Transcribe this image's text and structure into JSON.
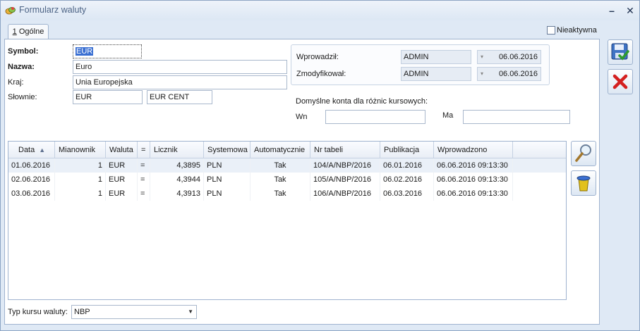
{
  "window": {
    "title": "Formularz waluty"
  },
  "tabs": [
    {
      "accel": "1",
      "label": " Ogólne"
    }
  ],
  "nieaktywna_label": "Nieaktywna",
  "form": {
    "symbol_label": "Symbol:",
    "symbol_value": "EUR",
    "nazwa_label": "Nazwa:",
    "nazwa_value": "Euro",
    "kraj_label": "Kraj:",
    "kraj_value": "Unia Europejska",
    "slownie_label": "Słownie:",
    "slownie_value1": "EUR",
    "slownie_value2": "EUR CENT"
  },
  "info": {
    "wprowadzil_label": "Wprowadził:",
    "wprowadzil_user": "ADMIN",
    "wprowadzil_date": "06.06.2016",
    "zmodyfikowal_label": "Zmodyfikował:",
    "zmodyfikowal_user": "ADMIN",
    "zmodyfikowal_date": "06.06.2016"
  },
  "konta": {
    "title": "Domyślne konta dla różnic kursowych:",
    "wn_label": "Wn",
    "wn_value": "",
    "ma_label": "Ma",
    "ma_value": ""
  },
  "grid": {
    "columns": [
      "Data",
      "Mianownik",
      "Waluta",
      "=",
      "Licznik",
      "Systemowa",
      "Automatycznie",
      "Nr tabeli",
      "Publikacja",
      "Wprowadzono"
    ],
    "rows": [
      [
        "01.06.2016",
        "1",
        "EUR",
        "=",
        "4,3895",
        "PLN",
        "Tak",
        "104/A/NBP/2016",
        "06.01.2016",
        "06.06.2016 09:13:30"
      ],
      [
        "02.06.2016",
        "1",
        "EUR",
        "=",
        "4,3944",
        "PLN",
        "Tak",
        "105/A/NBP/2016",
        "06.02.2016",
        "06.06.2016 09:13:30"
      ],
      [
        "03.06.2016",
        "1",
        "EUR",
        "=",
        "4,3913",
        "PLN",
        "Tak",
        "106/A/NBP/2016",
        "06.03.2016",
        "06.06.2016 09:13:30"
      ]
    ]
  },
  "footer": {
    "typ_label": "Typ kursu waluty:",
    "typ_value": "NBP"
  },
  "icons": {
    "save": "save-icon",
    "cancel": "cancel-icon",
    "preview": "magnifier-icon",
    "delete": "trash-icon",
    "close": "close-icon",
    "minimize": "minimize-icon",
    "app": "app-icon"
  },
  "colors": {
    "accent": "#3a6fd2",
    "delete_red": "#d42020",
    "window_bg": "#dfe9f5"
  }
}
